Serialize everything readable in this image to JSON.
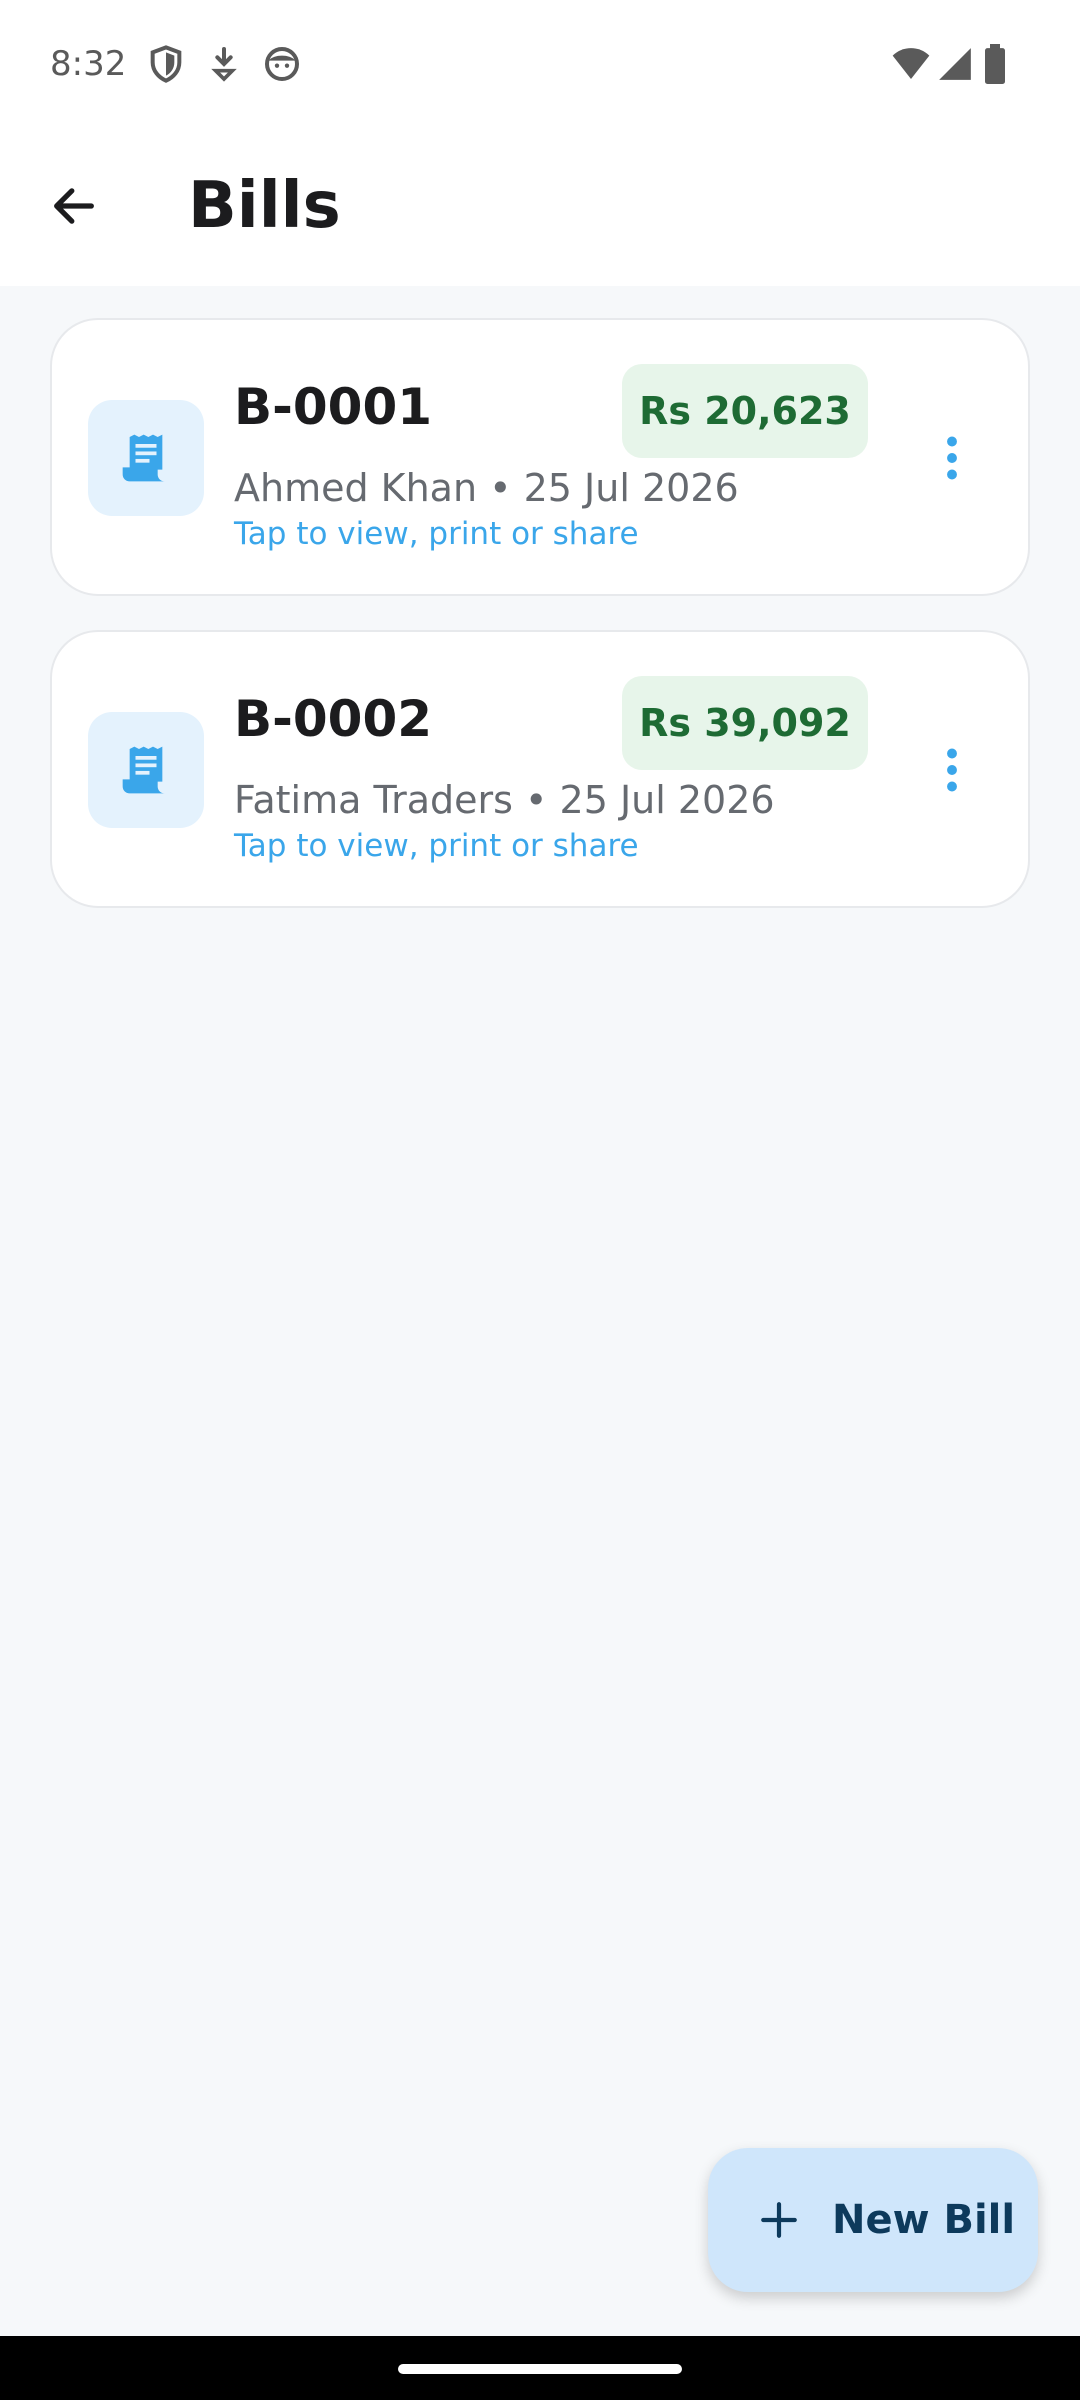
{
  "status_bar": {
    "time": "8:32",
    "left_icons": [
      "shield-icon",
      "download-icon",
      "face-icon"
    ],
    "right_icons": [
      "wifi-icon",
      "signal-icon",
      "battery-icon"
    ]
  },
  "app_bar": {
    "title": "Bills",
    "back_icon": "arrow-left-icon"
  },
  "bills": [
    {
      "number": "B-0001",
      "amount": "Rs 20,623",
      "meta": "Ahmed Khan • 25 Jul 2026",
      "hint": "Tap to view, print or share",
      "icon": "receipt-icon"
    },
    {
      "number": "B-0002",
      "amount": "Rs 39,092",
      "meta": "Fatima Traders • 25 Jul 2026",
      "hint": "Tap to view, print or share",
      "icon": "receipt-icon"
    }
  ],
  "fab": {
    "label": "New Bill",
    "icon": "plus-icon"
  },
  "colors": {
    "accent": "#3aa6ea",
    "amount_text": "#1e6b34",
    "amount_bg": "#e7f5ea",
    "fab_bg": "#cfe6fb",
    "background": "#f6f8fa"
  }
}
